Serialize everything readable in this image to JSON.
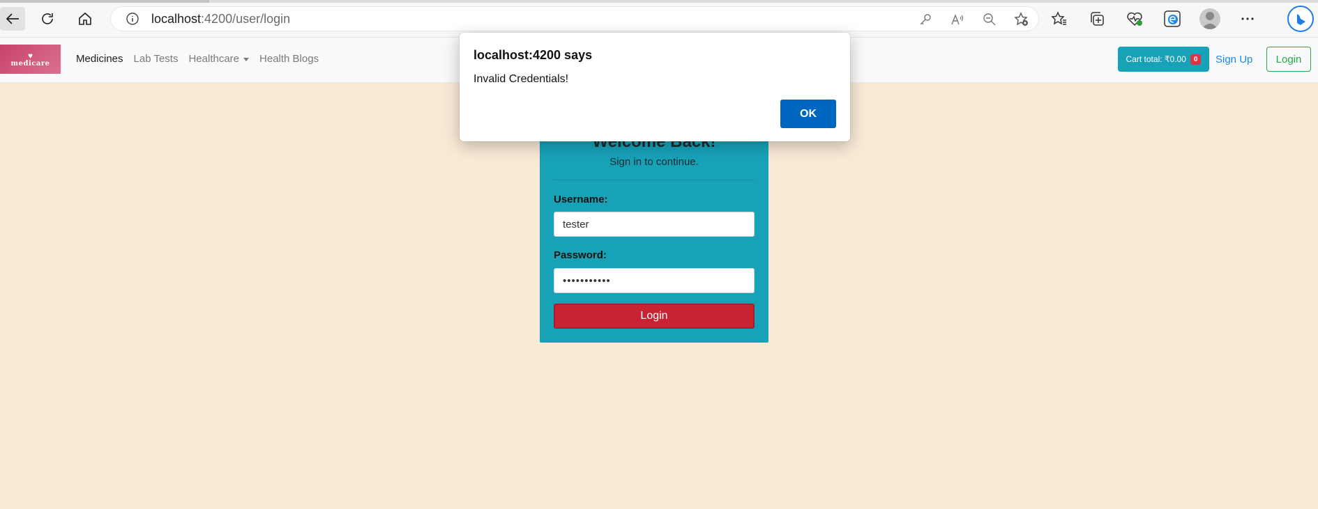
{
  "browser": {
    "url_host": "localhost",
    "url_path": ":4200/user/login",
    "icons": {
      "back": "back-arrow-icon",
      "reload": "reload-icon",
      "home": "home-icon",
      "info": "info-icon",
      "key": "key-icon",
      "read_aloud": "read-aloud-icon",
      "zoom": "zoom-out-icon",
      "favorite_add": "add-favorite-icon",
      "favorites": "favorites-icon",
      "collections": "collections-icon",
      "health": "browser-essentials-icon",
      "edge": "edge-icon",
      "profile": "profile-icon",
      "menu": "more-icon",
      "bing": "bing-icon"
    }
  },
  "site_nav": {
    "logo_text": "medicare",
    "links": [
      "Medicines",
      "Lab Tests",
      "Healthcare",
      "Health Blogs"
    ],
    "cart_label": "Cart total: ₹0.00",
    "cart_count": "0",
    "signup_label": "Sign Up",
    "login_label": "Login"
  },
  "login_card": {
    "heading": "Welcome Back!",
    "subtitle": "Sign in to continue.",
    "username_label": "Username:",
    "username_value": "tester",
    "password_label": "Password:",
    "password_value": "•••••••••••",
    "submit_label": "Login"
  },
  "dialog": {
    "title": "localhost:4200 says",
    "message": "Invalid Credentials!",
    "ok_label": "OK"
  },
  "colors": {
    "page_bg": "#f9e9d5",
    "card_bg": "#17a2b8",
    "login_btn": "#c82333",
    "ok_btn": "#0067c0",
    "signup": "#1e88e5",
    "login_outline": "#28a745"
  }
}
